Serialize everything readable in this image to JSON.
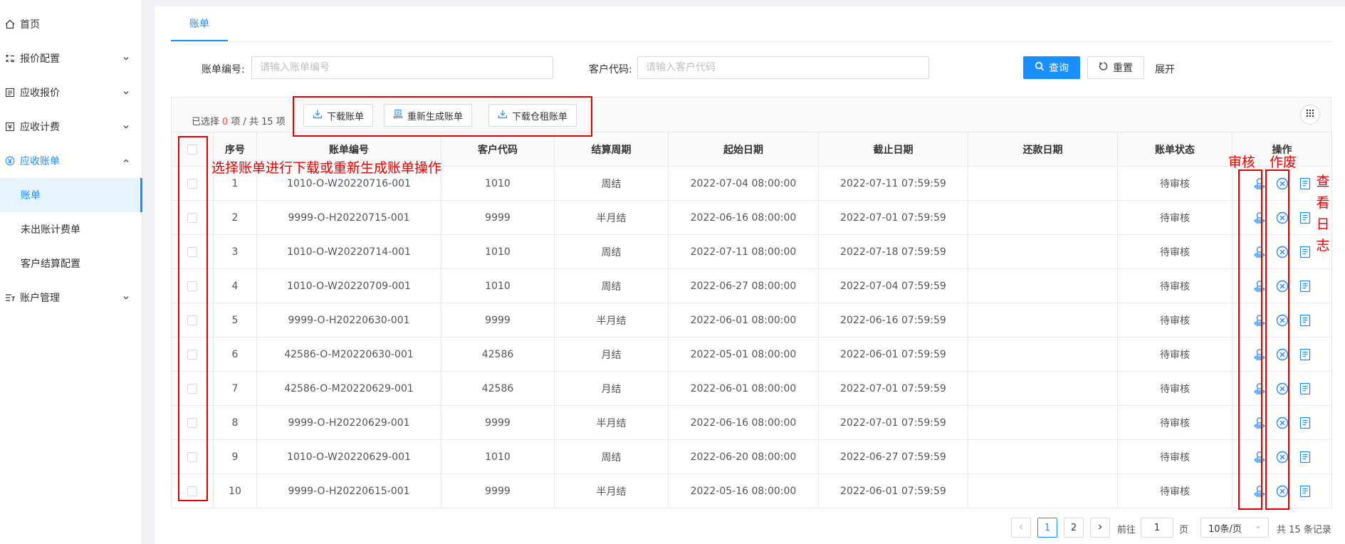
{
  "sidebar": {
    "items": [
      {
        "label": "首页",
        "icon": "home-icon"
      },
      {
        "label": "报价配置",
        "icon": "calculator-icon"
      },
      {
        "label": "应收报价",
        "icon": "quote-icon"
      },
      {
        "label": "应收计费",
        "icon": "billing-icon"
      },
      {
        "label": "应收账单",
        "icon": "yen-icon"
      },
      {
        "label": "账单"
      },
      {
        "label": "未出账计费单"
      },
      {
        "label": "客户结算配置"
      },
      {
        "label": "账户管理",
        "icon": "account-icon"
      }
    ]
  },
  "tab": {
    "label": "账单"
  },
  "search": {
    "bill_no_label": "账单编号:",
    "bill_no_placeholder": "请输入账单编号",
    "customer_label": "客户代码:",
    "customer_placeholder": "请输入客户代码",
    "query": "查询",
    "reset": "重置",
    "expand": "展开"
  },
  "toolbar": {
    "selected_prefix": "已选择",
    "selected_count": "0",
    "selected_suffix": "项 / 共 15 项",
    "download": "下载账单",
    "regenerate": "重新生成账单",
    "download_storage": "下载仓租账单"
  },
  "table": {
    "headers": [
      "序号",
      "账单编号",
      "客户代码",
      "结算周期",
      "起始日期",
      "截止日期",
      "还款日期",
      "账单状态",
      "操作"
    ],
    "rows": [
      [
        "1",
        "1010-O-W20220716-001",
        "1010",
        "周结",
        "2022-07-04 08:00:00",
        "2022-07-11 07:59:59",
        "",
        "待审核"
      ],
      [
        "2",
        "9999-O-H20220715-001",
        "9999",
        "半月结",
        "2022-06-16 08:00:00",
        "2022-07-01 07:59:59",
        "",
        "待审核"
      ],
      [
        "3",
        "1010-O-W20220714-001",
        "1010",
        "周结",
        "2022-07-11 08:00:00",
        "2022-07-18 07:59:59",
        "",
        "待审核"
      ],
      [
        "4",
        "1010-O-W20220709-001",
        "1010",
        "周结",
        "2022-06-27 08:00:00",
        "2022-07-04 07:59:59",
        "",
        "待审核"
      ],
      [
        "5",
        "9999-O-H20220630-001",
        "9999",
        "半月结",
        "2022-06-01 08:00:00",
        "2022-06-16 07:59:59",
        "",
        "待审核"
      ],
      [
        "6",
        "42586-O-M20220630-001",
        "42586",
        "月结",
        "2022-05-01 08:00:00",
        "2022-06-01 07:59:59",
        "",
        "待审核"
      ],
      [
        "7",
        "42586-O-M20220629-001",
        "42586",
        "月结",
        "2022-06-01 08:00:00",
        "2022-07-01 07:59:59",
        "",
        "待审核"
      ],
      [
        "8",
        "9999-O-H20220629-001",
        "9999",
        "半月结",
        "2022-06-16 08:00:00",
        "2022-07-01 07:59:59",
        "",
        "待审核"
      ],
      [
        "9",
        "1010-O-W20220629-001",
        "1010",
        "周结",
        "2022-06-20 08:00:00",
        "2022-06-27 07:59:59",
        "",
        "待审核"
      ],
      [
        "10",
        "9999-O-H20220615-001",
        "9999",
        "半月结",
        "2022-05-16 08:00:00",
        "2022-06-01 07:59:59",
        "",
        "待审核"
      ]
    ]
  },
  "annotations": {
    "select_note": "选择账单进行下载或重新生成账单操作",
    "audit": "审核",
    "void": "作废",
    "log_chars": [
      "查",
      "看",
      "日",
      "志"
    ]
  },
  "pagination": {
    "page1": "1",
    "page2": "2",
    "goto_prefix": "前往",
    "goto_value": "1",
    "goto_suffix": "页",
    "page_size": "10条/页",
    "total": "共 15 条记录"
  },
  "colors": {
    "accent": "#1890ff",
    "annotation": "#e60000"
  }
}
